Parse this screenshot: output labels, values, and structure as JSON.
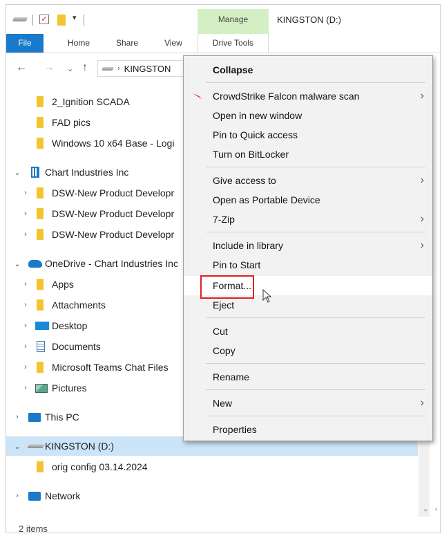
{
  "ribbon": {
    "manage_label": "Manage",
    "window_title": "KINGSTON (D:)",
    "tabs": [
      "File",
      "Home",
      "Share",
      "View",
      "Drive Tools"
    ]
  },
  "address": {
    "back_icon": "arrow-left-icon",
    "path_segment": "KINGSTON"
  },
  "tree": {
    "items": [
      {
        "label": "2_Ignition SCADA",
        "icon": "folder"
      },
      {
        "label": "FAD pics",
        "icon": "folder"
      },
      {
        "label": "Windows 10 x64 Base - Logi",
        "icon": "folder"
      },
      {
        "label": "Chart Industries Inc",
        "icon": "building"
      },
      {
        "label": "DSW-New Product Developr",
        "icon": "folder"
      },
      {
        "label": "DSW-New Product Developr",
        "icon": "folder"
      },
      {
        "label": "DSW-New Product Developr",
        "icon": "folder"
      },
      {
        "label": "OneDrive - Chart Industries Inc",
        "icon": "cloud"
      },
      {
        "label": "Apps",
        "icon": "folder"
      },
      {
        "label": "Attachments",
        "icon": "folder"
      },
      {
        "label": "Desktop",
        "icon": "desktop"
      },
      {
        "label": "Documents",
        "icon": "documents"
      },
      {
        "label": "Microsoft Teams Chat Files",
        "icon": "folder"
      },
      {
        "label": "Pictures",
        "icon": "pictures"
      },
      {
        "label": "This PC",
        "icon": "pc"
      },
      {
        "label": "KINGSTON (D:)",
        "icon": "drive"
      },
      {
        "label": "orig config 03.14.2024",
        "icon": "folder"
      },
      {
        "label": "Network",
        "icon": "network"
      }
    ]
  },
  "status": {
    "items_count": "2 items"
  },
  "context_menu": {
    "items": [
      {
        "label": "Collapse"
      },
      {
        "label": "CrowdStrike Falcon malware scan"
      },
      {
        "label": "Open in new window"
      },
      {
        "label": "Pin to Quick access"
      },
      {
        "label": "Turn on BitLocker"
      },
      {
        "label": "Give access to"
      },
      {
        "label": "Open as Portable Device"
      },
      {
        "label": "7-Zip"
      },
      {
        "label": "Include in library"
      },
      {
        "label": "Pin to Start"
      },
      {
        "label": "Format..."
      },
      {
        "label": "Eject"
      },
      {
        "label": "Cut"
      },
      {
        "label": "Copy"
      },
      {
        "label": "Rename"
      },
      {
        "label": "New"
      },
      {
        "label": "Properties"
      }
    ]
  },
  "colors": {
    "accent": "#1979ca",
    "manage_tab": "#d4efc4",
    "selection": "#cce4f7",
    "highlight_box": "#e02020"
  }
}
